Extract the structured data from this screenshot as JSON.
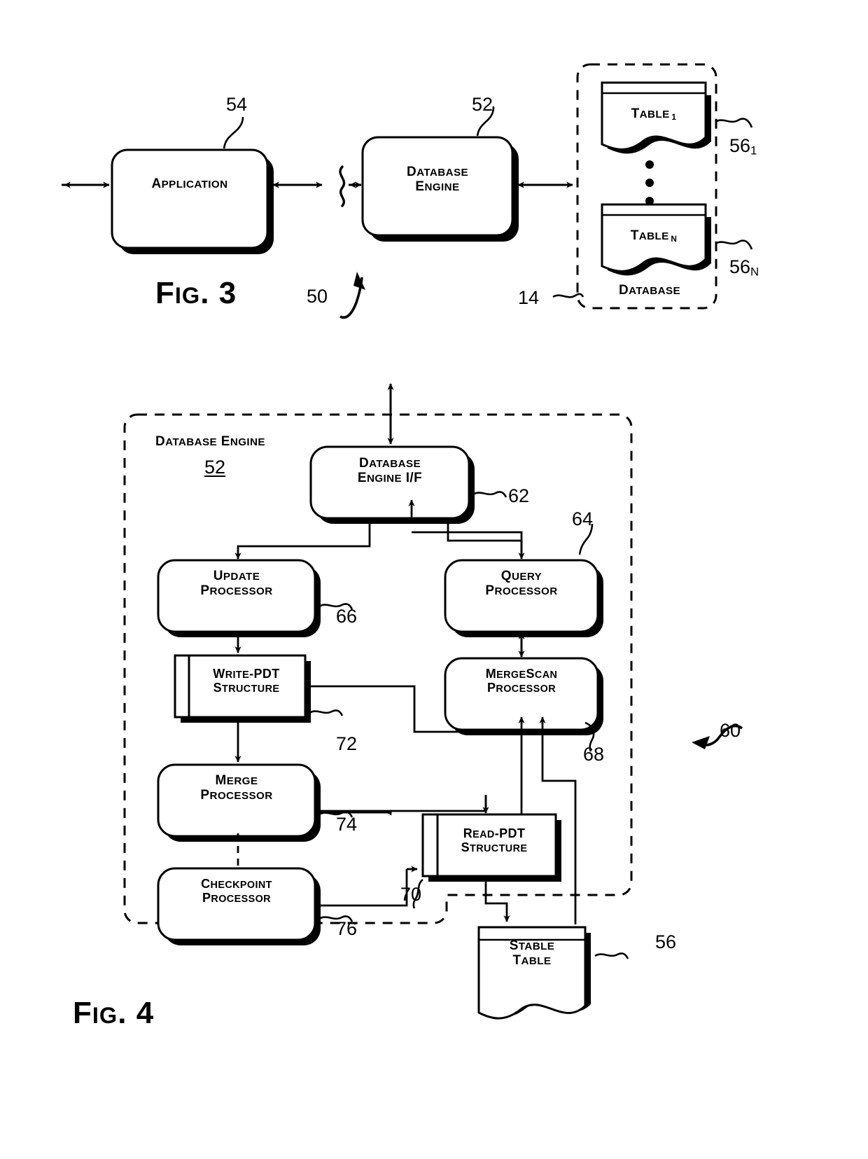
{
  "document": {
    "type": "patent-drawing-sheet",
    "figures": [
      "FIG. 3",
      "FIG. 4"
    ]
  },
  "fig3": {
    "caption_big": "F",
    "caption": "FIG. 3",
    "caption_parts": {
      "f": "F",
      "ig": "IG",
      "dot": ". ",
      "num": "3"
    },
    "system_ref": "50",
    "database_ref": "14",
    "blocks": [
      {
        "id": "application",
        "label_line1": "Application",
        "label_line2": "",
        "ref": "54"
      },
      {
        "id": "database-engine",
        "label_line1": "Database",
        "label_line2": "Engine",
        "ref": "52"
      }
    ],
    "database": {
      "label": "Database",
      "ref": "14",
      "tables": [
        {
          "label_main": "Table",
          "label_sub": "1",
          "ref_main": "56",
          "ref_sub": "1"
        },
        {
          "label_main": "Table",
          "label_sub": "N",
          "ref_main": "56",
          "ref_sub": "N"
        }
      ],
      "ellipsis": "⋮"
    }
  },
  "fig4": {
    "caption": "FIG. 4",
    "caption_parts": {
      "f": "F",
      "ig": "IG",
      "dot": ". ",
      "num": "4"
    },
    "system_ref": "60",
    "container_title": "Database Engine",
    "container_ref": "52",
    "blocks": [
      {
        "id": "database-engine-if",
        "line1": "Database",
        "line2": "Engine I/F",
        "ref": "62",
        "shape": "rounded"
      },
      {
        "id": "update-processor",
        "line1": "Update",
        "line2": "Processor",
        "ref": "66",
        "shape": "rounded"
      },
      {
        "id": "query-processor",
        "line1": "Query",
        "line2": "Processor",
        "ref": "64",
        "shape": "rounded"
      },
      {
        "id": "write-pdt",
        "line1": "Write-PDT",
        "line2": "Structure",
        "ref": "72",
        "shape": "process"
      },
      {
        "id": "mergescan-processor",
        "line1": "MergeScan",
        "line2": "Processor",
        "ref": "68",
        "shape": "rounded"
      },
      {
        "id": "merge-processor",
        "line1": "Merge",
        "line2": "Processor",
        "ref": "74",
        "shape": "rounded"
      },
      {
        "id": "read-pdt",
        "line1": "Read-PDT",
        "line2": "Structure",
        "ref": "70",
        "shape": "process"
      },
      {
        "id": "checkpoint-processor",
        "line1": "Checkpoint",
        "line2": "Processor",
        "ref": "76",
        "shape": "rounded"
      },
      {
        "id": "stable-table",
        "line1": "Stable",
        "line2": "Table",
        "ref": "56",
        "shape": "document"
      }
    ]
  },
  "colors": {
    "ink": "#000000",
    "paper": "#ffffff"
  }
}
